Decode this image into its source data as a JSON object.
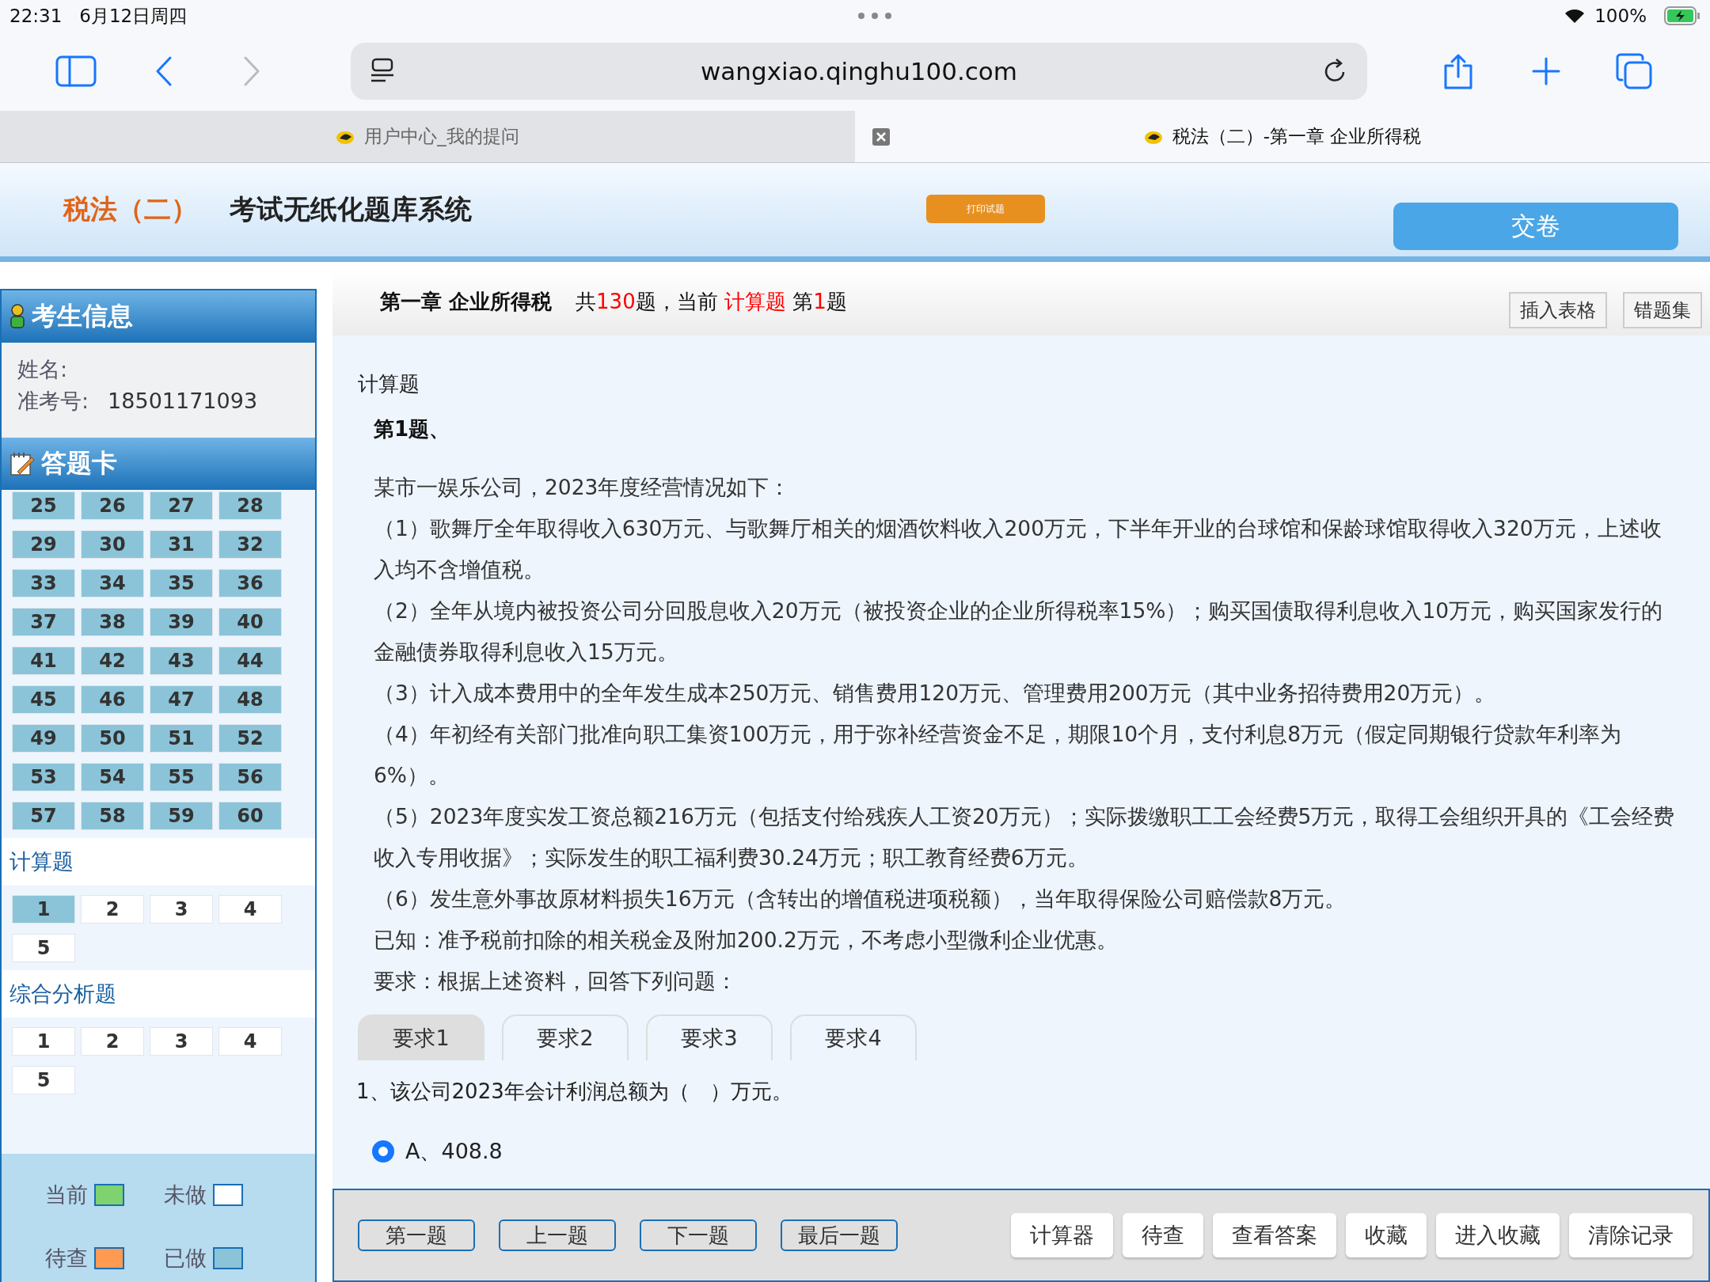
{
  "status_bar": {
    "time": "22:31",
    "date": "6月12日周四",
    "battery": "100%"
  },
  "browser": {
    "url": "wangxiao.qinghu100.com",
    "tabs": [
      {
        "title": "用户中心_我的提问",
        "selected": false
      },
      {
        "title": "税法（二）-第一章 企业所得税",
        "selected": true
      }
    ]
  },
  "header": {
    "subject": "税法（二）",
    "system_title": "考试无纸化题库系统",
    "print_button": "打印试题",
    "submit_button": "交卷"
  },
  "sidebar": {
    "candidate_title": "考生信息",
    "fields": [
      {
        "label": "姓名:"
      },
      {
        "label": "准考号:",
        "value": "18501171093"
      }
    ],
    "answer_card_title": "答题卡",
    "sections": [
      {
        "items": [
          {
            "label": "25",
            "kind": "done"
          },
          {
            "label": "26",
            "kind": "done"
          },
          {
            "label": "27",
            "kind": "done"
          },
          {
            "label": "28",
            "kind": "done"
          },
          {
            "label": "29",
            "kind": "done"
          },
          {
            "label": "30",
            "kind": "done"
          },
          {
            "label": "31",
            "kind": "done"
          },
          {
            "label": "32",
            "kind": "done"
          },
          {
            "label": "33",
            "kind": "done"
          },
          {
            "label": "34",
            "kind": "done"
          },
          {
            "label": "35",
            "kind": "done"
          },
          {
            "label": "36",
            "kind": "done"
          },
          {
            "label": "37",
            "kind": "done"
          },
          {
            "label": "38",
            "kind": "done"
          },
          {
            "label": "39",
            "kind": "done"
          },
          {
            "label": "40",
            "kind": "done"
          },
          {
            "label": "41",
            "kind": "done"
          },
          {
            "label": "42",
            "kind": "done"
          },
          {
            "label": "43",
            "kind": "done"
          },
          {
            "label": "44",
            "kind": "done"
          },
          {
            "label": "45",
            "kind": "done"
          },
          {
            "label": "46",
            "kind": "done"
          },
          {
            "label": "47",
            "kind": "done"
          },
          {
            "label": "48",
            "kind": "done"
          },
          {
            "label": "49",
            "kind": "done"
          },
          {
            "label": "50",
            "kind": "done"
          },
          {
            "label": "51",
            "kind": "done"
          },
          {
            "label": "52",
            "kind": "done"
          },
          {
            "label": "53",
            "kind": "done"
          },
          {
            "label": "54",
            "kind": "done"
          },
          {
            "label": "55",
            "kind": "done"
          },
          {
            "label": "56",
            "kind": "done"
          },
          {
            "label": "57",
            "kind": "done"
          },
          {
            "label": "58",
            "kind": "done"
          },
          {
            "label": "59",
            "kind": "done"
          },
          {
            "label": "60",
            "kind": "done"
          }
        ]
      },
      {
        "title": "计算题",
        "items": [
          {
            "label": "1",
            "kind": "done"
          },
          {
            "label": "2",
            "kind": "todo"
          },
          {
            "label": "3",
            "kind": "todo"
          },
          {
            "label": "4",
            "kind": "todo"
          },
          {
            "label": "5",
            "kind": "todo"
          }
        ]
      },
      {
        "title": "综合分析题",
        "items": [
          {
            "label": "1",
            "kind": "todo"
          },
          {
            "label": "2",
            "kind": "todo"
          },
          {
            "label": "3",
            "kind": "todo"
          },
          {
            "label": "4",
            "kind": "todo"
          },
          {
            "label": "5",
            "kind": "todo"
          }
        ]
      }
    ],
    "legend": [
      {
        "label": "当前",
        "kind": "current"
      },
      {
        "label": "未做",
        "kind": "todo"
      },
      {
        "label": "待查",
        "kind": "pending"
      },
      {
        "label": "已做",
        "kind": "done"
      }
    ]
  },
  "main": {
    "chapter": "第一章 企业所得税",
    "progress": [
      {
        "text": "共",
        "highlight": false
      },
      {
        "text": "130",
        "highlight": true
      },
      {
        "text": "题，当前 ",
        "highlight": false
      },
      {
        "text": "计算题",
        "highlight": true
      },
      {
        "text": " 第",
        "highlight": false
      },
      {
        "text": "1",
        "highlight": true
      },
      {
        "text": "题",
        "highlight": false
      }
    ],
    "tool_buttons": [
      "插入表格",
      "错题集"
    ],
    "question_type": "计算题",
    "question_number": "第1题、",
    "paragraphs": [
      "某市一娱乐公司，2023年度经营情况如下：",
      "（1）歌舞厅全年取得收入630万元、与歌舞厅相关的烟酒饮料收入200万元，下半年开业的台球馆和保龄球馆取得收入320万元，上述收入均不含增值税。",
      "（2）全年从境内被投资公司分回股息收入20万元（被投资企业的企业所得税率15%）；购买国债取得利息收入10万元，购买国家发行的金融债券取得利息收入15万元。",
      "（3）计入成本费用中的全年发生成本250万元、销售费用120万元、管理费用200万元（其中业务招待费用20万元）。",
      "（4）年初经有关部门批准向职工集资100万元，用于弥补经营资金不足，期限10个月，支付利息8万元（假定同期银行贷款年利率为6%）。",
      "（5）2023年度实发工资总额216万元（包括支付给残疾人工资20万元）；实际拨缴职工工会经费5万元，取得工会组织开具的《工会经费收入专用收据》；实际发生的职工福利费30.24万元；职工教育经费6万元。",
      "（6）发生意外事故原材料损失16万元（含转出的增值税进项税额），当年取得保险公司赔偿款8万元。",
      "已知：准予税前扣除的相关税金及附加200.2万元，不考虑小型微利企业优惠。",
      "要求：根据上述资料，回答下列问题："
    ],
    "subtabs": [
      {
        "label": "要求1",
        "selected": true
      },
      {
        "label": "要求2",
        "selected": false
      },
      {
        "label": "要求3",
        "selected": false
      },
      {
        "label": "要求4",
        "selected": false
      }
    ],
    "sub_question": "1、该公司2023年会计利润总额为（　）万元。",
    "option": {
      "label": "A、408.8",
      "selected": true
    },
    "nav_buttons": [
      "第一题",
      "上一题",
      "下一题",
      "最后一题"
    ],
    "action_buttons": [
      "计算器",
      "待查",
      "查看答案",
      "收藏",
      "进入收藏",
      "清除记录"
    ]
  }
}
